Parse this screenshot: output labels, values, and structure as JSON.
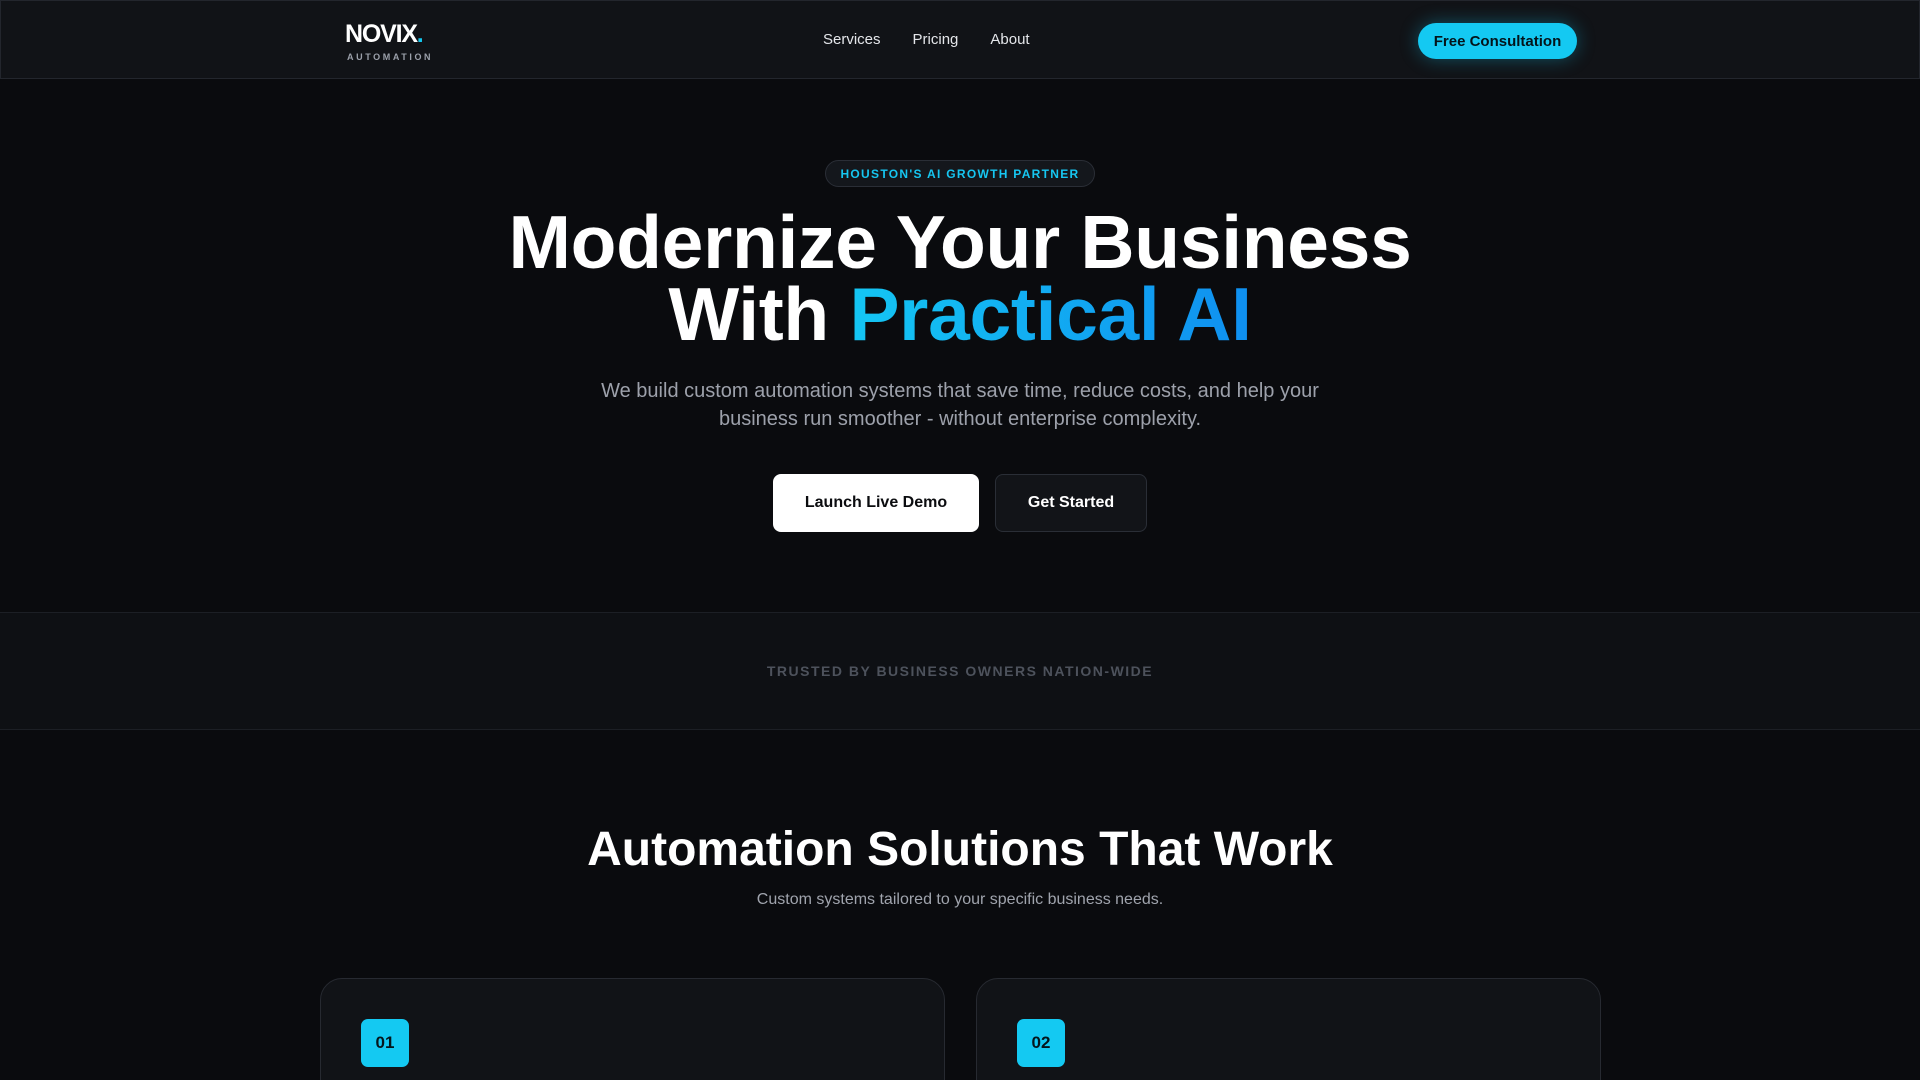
{
  "header": {
    "logo_text": "NOVIX",
    "logo_dot": ".",
    "logo_sub": "AUTOMATION",
    "nav": [
      "Services",
      "Pricing",
      "About"
    ],
    "cta_label": "Free Consultation"
  },
  "hero": {
    "badge": "HOUSTON'S AI GROWTH PARTNER",
    "title_line1": "Modernize Your Business",
    "title_line2_prefix": "With ",
    "title_line2_accent": "Practical AI",
    "subtitle": "We build custom automation systems that save time, reduce costs, and help your business run smoother - without enterprise complexity.",
    "primary_button": "Launch Live Demo",
    "secondary_button": "Get Started"
  },
  "trusted": {
    "text": "TRUSTED BY BUSINESS OWNERS NATION-WIDE"
  },
  "solutions": {
    "title": "Automation Solutions That Work",
    "subtitle": "Custom systems tailored to your specific business needs.",
    "cards": [
      {
        "number": "01"
      },
      {
        "number": "02"
      }
    ]
  },
  "colors": {
    "accent": "#14c9f2",
    "accent_gradient_end": "#0f8ff0",
    "background": "#0a0b0e",
    "surface": "#111317"
  }
}
